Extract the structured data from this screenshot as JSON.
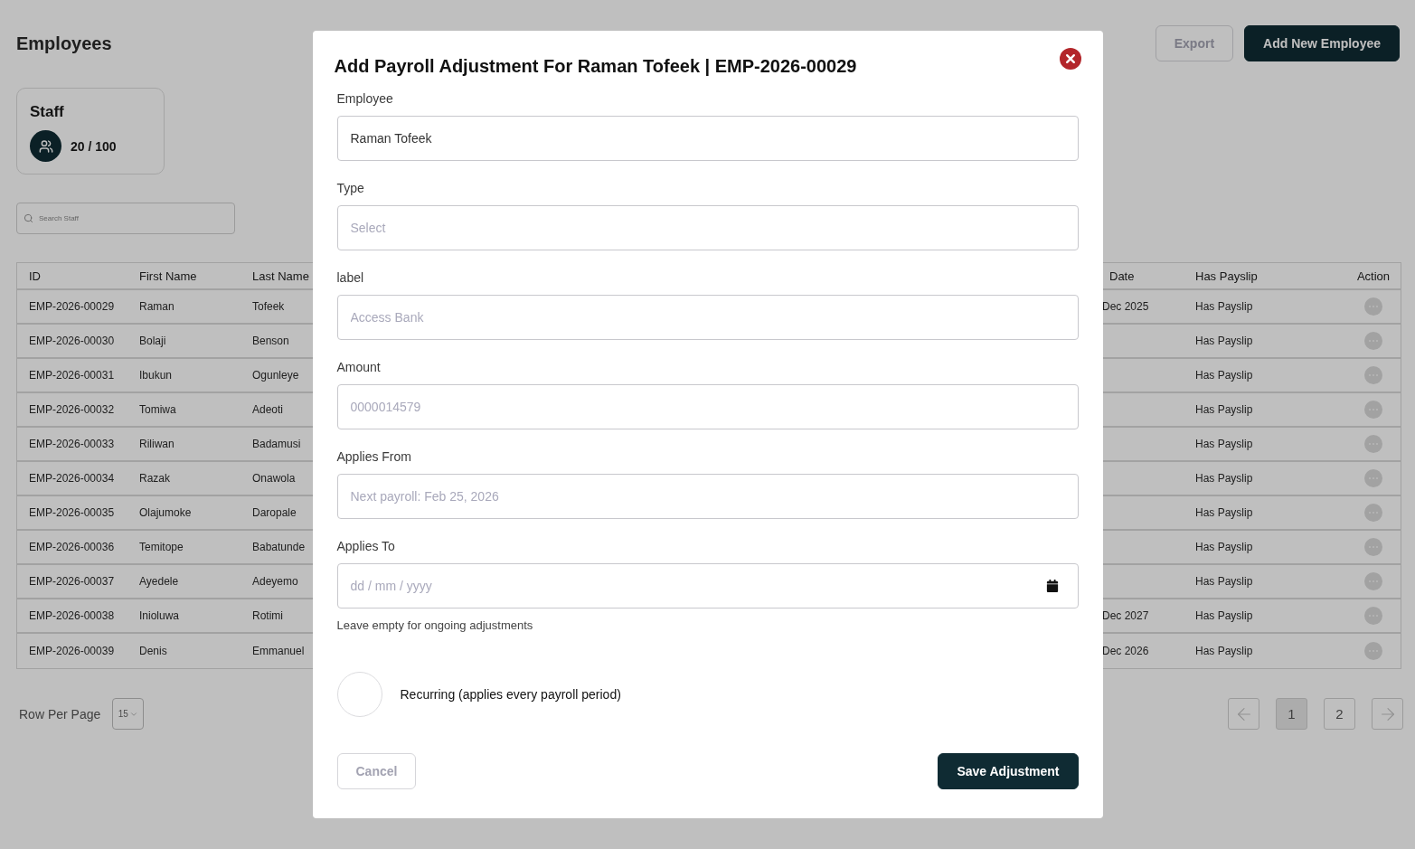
{
  "page": {
    "title": "Employees",
    "buttons": [
      {
        "kind": "secondary",
        "label": "Export"
      },
      {
        "kind": "primary",
        "label": "Add New Employee"
      }
    ]
  },
  "staff_card": {
    "title": "Staff",
    "count": "20 / 100"
  },
  "search": {
    "placeholder": "Search Staff"
  },
  "table": {
    "columns": [
      "ID",
      "First Name",
      "Last Name",
      "Date",
      "Has Payslip",
      "Action"
    ],
    "rows": [
      {
        "id": "EMP-2026-00029",
        "first_name": "Raman",
        "last_name": "Tofeek",
        "date": "Dec 2025",
        "has_payslip": "Has Payslip"
      },
      {
        "id": "EMP-2026-00030",
        "first_name": "Bolaji",
        "last_name": "Benson",
        "has_payslip": "Has Payslip"
      },
      {
        "id": "EMP-2026-00031",
        "first_name": "Ibukun",
        "last_name": "Ogunleye",
        "has_payslip": "Has Payslip"
      },
      {
        "id": "EMP-2026-00032",
        "first_name": "Tomiwa",
        "last_name": "Adeoti",
        "has_payslip": "Has Payslip"
      },
      {
        "id": "EMP-2026-00033",
        "first_name": "Riliwan",
        "last_name": "Badamusi",
        "has_payslip": "Has Payslip"
      },
      {
        "id": "EMP-2026-00034",
        "first_name": "Razak",
        "last_name": "Onawola",
        "has_payslip": "Has Payslip"
      },
      {
        "id": "EMP-2026-00035",
        "first_name": "Olajumoke",
        "last_name": "Daropale",
        "has_payslip": "Has Payslip"
      },
      {
        "id": "EMP-2026-00036",
        "first_name": "Temitope",
        "last_name": "Babatunde",
        "has_payslip": "Has Payslip"
      },
      {
        "id": "EMP-2026-00037",
        "first_name": "Ayedele",
        "last_name": "Adeyemo",
        "has_payslip": "Has Payslip"
      },
      {
        "id": "EMP-2026-00038",
        "first_name": "Inioluwa",
        "last_name": "Rotimi",
        "date": "Dec 2027",
        "has_payslip": "Has Payslip"
      },
      {
        "id": "EMP-2026-00039",
        "first_name": "Denis",
        "last_name": "Emmanuel",
        "date": "Dec 2026",
        "has_payslip": "Has Payslip"
      }
    ]
  },
  "pagination": {
    "rows_per_page_label": "Row Per Page",
    "rows_per_page": "15",
    "pages": [
      {
        "label": "1",
        "selected": true
      },
      {
        "label": "2",
        "selected": false
      }
    ]
  },
  "modal": {
    "title": "Add Payroll Adjustment For Raman Tofeek | EMP-2026-00029",
    "fields": [
      {
        "kind": "text",
        "label": "Employee",
        "value": "Raman Tofeek"
      },
      {
        "kind": "text",
        "label": "Type",
        "placeholder": "Select"
      },
      {
        "kind": "text",
        "label": "label",
        "placeholder": "Access Bank"
      },
      {
        "kind": "text",
        "label": "Amount",
        "placeholder": "0000014579"
      },
      {
        "kind": "text",
        "label": "Applies From",
        "placeholder": "Next payroll: Feb 25, 2026"
      },
      {
        "kind": "date",
        "label": "Applies To",
        "placeholder": "dd / mm / yyyy",
        "hint": "Leave empty for ongoing adjustments"
      }
    ],
    "recurring": {
      "label": "Recurring (applies every payroll period)",
      "checked": false
    },
    "buttons": [
      {
        "kind": "secondary",
        "label": "Cancel"
      },
      {
        "kind": "primary",
        "label": "Save Adjustment"
      }
    ]
  }
}
